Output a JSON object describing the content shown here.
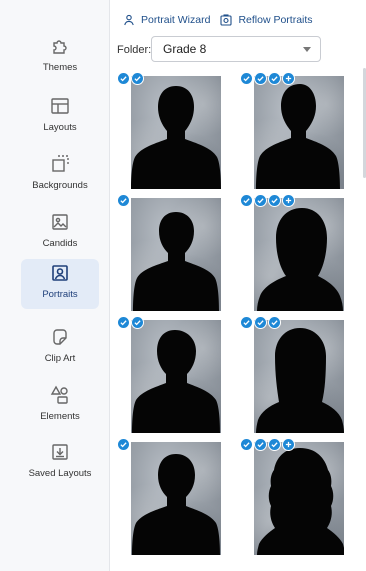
{
  "sidebar": {
    "items": [
      {
        "label": "Themes",
        "icon": "puzzle-icon"
      },
      {
        "label": "Layouts",
        "icon": "layout-icon"
      },
      {
        "label": "Backgrounds",
        "icon": "background-icon"
      },
      {
        "label": "Candids",
        "icon": "image-icon"
      },
      {
        "label": "Portraits",
        "icon": "portrait-icon",
        "active": true
      },
      {
        "label": "Clip Art",
        "icon": "sticker-icon"
      },
      {
        "label": "Elements",
        "icon": "shapes-icon"
      },
      {
        "label": "Saved Layouts",
        "icon": "download-icon"
      }
    ]
  },
  "toolbar": {
    "portrait_wizard": "Portrait Wizard",
    "reflow_portraits": "Reflow Portraits"
  },
  "folder": {
    "label": "Folder:",
    "selected": "Grade 8"
  },
  "portraits": [
    {
      "silhouette": "male",
      "badges": [
        "check",
        "check"
      ]
    },
    {
      "silhouette": "male",
      "badges": [
        "check",
        "check",
        "check",
        "plus"
      ]
    },
    {
      "silhouette": "male",
      "badges": [
        "check"
      ]
    },
    {
      "silhouette": "female-bob",
      "badges": [
        "check",
        "check",
        "check",
        "plus"
      ]
    },
    {
      "silhouette": "male",
      "badges": [
        "check",
        "check"
      ]
    },
    {
      "silhouette": "female-long",
      "badges": [
        "check",
        "check",
        "check"
      ]
    },
    {
      "silhouette": "male",
      "badges": [
        "check"
      ]
    },
    {
      "silhouette": "female-curly",
      "badges": [
        "check",
        "check",
        "check",
        "plus"
      ]
    }
  ],
  "colors": {
    "accent": "#1e88d6",
    "active_nav_bg": "#e3ebf7",
    "link": "#1f4f8a"
  }
}
